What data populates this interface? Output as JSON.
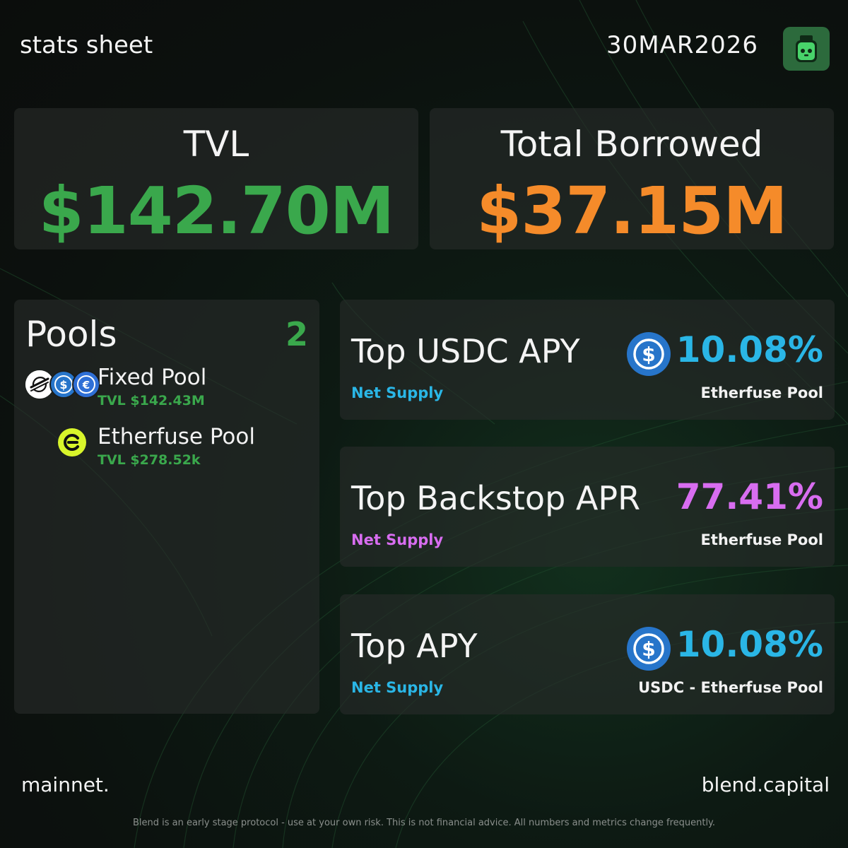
{
  "header": {
    "title": "stats sheet",
    "date": "30MAR2026",
    "logo_icon": "jar-mascot-icon"
  },
  "stats": {
    "tvl": {
      "label": "TVL",
      "value": "$142.70M",
      "color": "#3aa84c"
    },
    "borrowed": {
      "label": "Total Borrowed",
      "value": "$37.15M",
      "color": "#f58b2a"
    }
  },
  "pools": {
    "title": "Pools",
    "count": "2",
    "items": [
      {
        "name": "Fixed Pool",
        "tvl": "TVL $142.43M",
        "icons": [
          "stellar-icon",
          "usdc-icon",
          "euroc-icon"
        ]
      },
      {
        "name": "Etherfuse Pool",
        "tvl": "TVL $278.52k",
        "icons": [
          "etherfuse-icon"
        ]
      }
    ]
  },
  "metrics": [
    {
      "title": "Top USDC APY",
      "subtitle": "Net Supply",
      "value": "10.08%",
      "pool": "Etherfuse Pool",
      "icon": "usdc-icon",
      "accent": "#2ab6e6"
    },
    {
      "title": "Top Backstop APR",
      "subtitle": "Net Supply",
      "value": "77.41%",
      "pool": "Etherfuse Pool",
      "icon": "",
      "accent": "#d86df0"
    },
    {
      "title": "Top APY",
      "subtitle": "Net Supply",
      "value": "10.08%",
      "pool": "USDC - Etherfuse Pool",
      "icon": "usdc-icon",
      "accent": "#2ab6e6"
    }
  ],
  "footer": {
    "network": "mainnet.",
    "site": "blend.capital",
    "disclaimer": "Blend is an early stage protocol - use at your own risk. This is not financial advice. All numbers and metrics change frequently."
  }
}
